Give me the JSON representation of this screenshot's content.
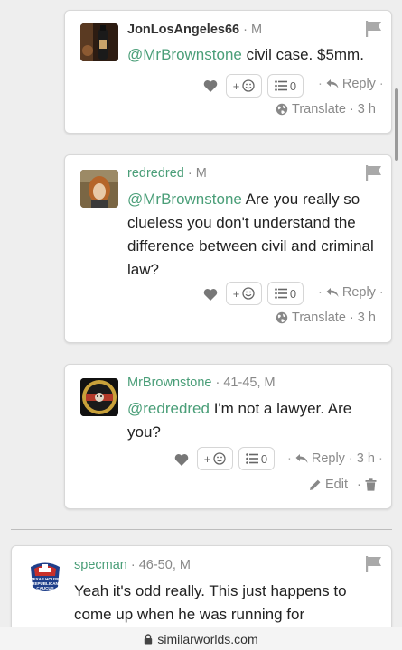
{
  "posts": [
    {
      "username": "JonLosAngeles66",
      "meta": " · M",
      "mention": "@MrBrownstone",
      "text": " civil case. $5mm.",
      "add_reaction": "+",
      "list_count": "0",
      "reply_label": "Reply",
      "translate_label": "Translate",
      "time": "3 h"
    },
    {
      "username": "redredred",
      "meta": " · M",
      "mention": "@MrBrownstone",
      "text": " Are you really so clueless you don't understand the difference between civil and criminal law?",
      "add_reaction": "+",
      "list_count": "0",
      "reply_label": "Reply",
      "translate_label": "Translate",
      "time": "3 h"
    },
    {
      "username": "MrBrownstone",
      "meta": " · 41-45, M",
      "mention": "@redredred",
      "text": " I'm not a lawyer. Are you?",
      "add_reaction": "+",
      "list_count": "0",
      "reply_label": "Reply",
      "time": "3 h",
      "edit_label": "Edit"
    },
    {
      "username": "specman",
      "meta": " · 46-50, M",
      "text": "Yeah it's odd really. This just happens to come up when he was running for",
      "avatar_text": "TEXAS HOUSE REPUBLICAN CAUCUS"
    }
  ],
  "url_bar": {
    "domain": "similarworlds.com"
  },
  "colors": {
    "accent_green": "#4a9e78",
    "muted": "#8a8a8a",
    "background": "#eeeeee"
  }
}
